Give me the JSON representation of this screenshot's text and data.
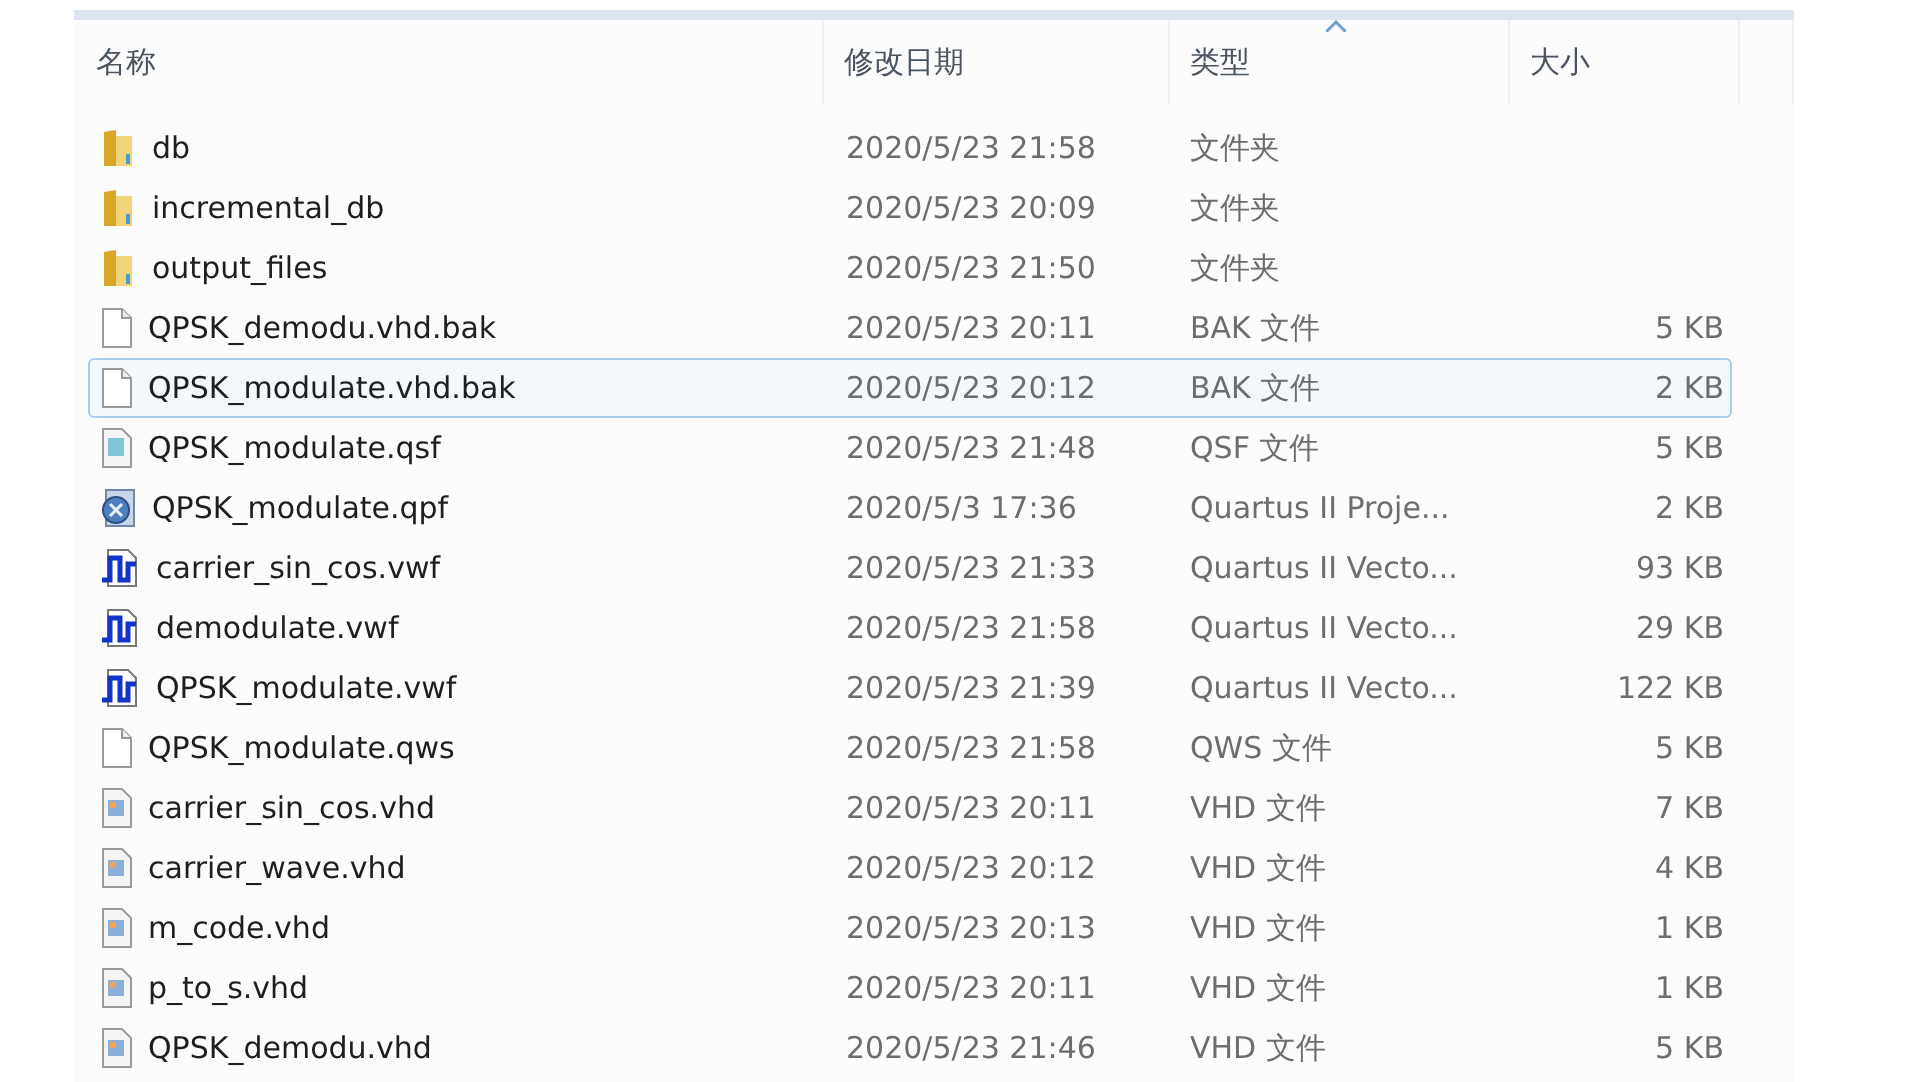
{
  "columns": [
    {
      "label": "名称",
      "sorted": false
    },
    {
      "label": "修改日期",
      "sorted": false
    },
    {
      "label": "类型",
      "sorted": true
    },
    {
      "label": "大小",
      "sorted": false
    }
  ],
  "files": [
    {
      "kind": "folder",
      "name": "db",
      "modified": "2020/5/23 21:58",
      "type": "文件夹",
      "selected": false
    },
    {
      "kind": "folder",
      "name": "incremental_db",
      "modified": "2020/5/23 20:09",
      "type": "文件夹",
      "selected": false
    },
    {
      "kind": "folder",
      "name": "output_files",
      "modified": "2020/5/23 21:50",
      "type": "文件夹",
      "selected": false
    },
    {
      "kind": "blank",
      "name": "QPSK_demodu.vhd.bak",
      "modified": "2020/5/23 20:11",
      "type": "BAK 文件",
      "size": "5 KB",
      "selected": false
    },
    {
      "kind": "blank",
      "name": "QPSK_modulate.vhd.bak",
      "modified": "2020/5/23 20:12",
      "type": "BAK 文件",
      "size": "2 KB",
      "selected": true
    },
    {
      "kind": "settings",
      "name": "QPSK_modulate.qsf",
      "modified": "2020/5/23 21:48",
      "type": "QSF 文件",
      "size": "5 KB",
      "selected": false
    },
    {
      "kind": "project",
      "name": "QPSK_modulate.qpf",
      "modified": "2020/5/3 17:36",
      "type": "Quartus II Proje...",
      "size": "2 KB",
      "selected": false
    },
    {
      "kind": "waveform",
      "name": "carrier_sin_cos.vwf",
      "modified": "2020/5/23 21:33",
      "type": "Quartus II Vecto...",
      "size": "93 KB",
      "selected": false
    },
    {
      "kind": "waveform",
      "name": "demodulate.vwf",
      "modified": "2020/5/23 21:58",
      "type": "Quartus II Vecto...",
      "size": "29 KB",
      "selected": false
    },
    {
      "kind": "waveform",
      "name": "QPSK_modulate.vwf",
      "modified": "2020/5/23 21:39",
      "type": "Quartus II Vecto...",
      "size": "122 KB",
      "selected": false
    },
    {
      "kind": "blank",
      "name": "QPSK_modulate.qws",
      "modified": "2020/5/23 21:58",
      "type": "QWS 文件",
      "size": "5 KB",
      "selected": false
    },
    {
      "kind": "source",
      "name": "carrier_sin_cos.vhd",
      "modified": "2020/5/23 20:11",
      "type": "VHD 文件",
      "size": "7 KB",
      "selected": false
    },
    {
      "kind": "source",
      "name": "carrier_wave.vhd",
      "modified": "2020/5/23 20:12",
      "type": "VHD 文件",
      "size": "4 KB",
      "selected": false
    },
    {
      "kind": "source",
      "name": "m_code.vhd",
      "modified": "2020/5/23 20:13",
      "type": "VHD 文件",
      "size": "1 KB",
      "selected": false
    },
    {
      "kind": "source",
      "name": "p_to_s.vhd",
      "modified": "2020/5/23 20:11",
      "type": "VHD 文件",
      "size": "1 KB",
      "selected": false
    },
    {
      "kind": "source",
      "name": "QPSK_demodu.vhd",
      "modified": "2020/5/23 21:46",
      "type": "VHD 文件",
      "size": "5 KB",
      "selected": false
    }
  ]
}
